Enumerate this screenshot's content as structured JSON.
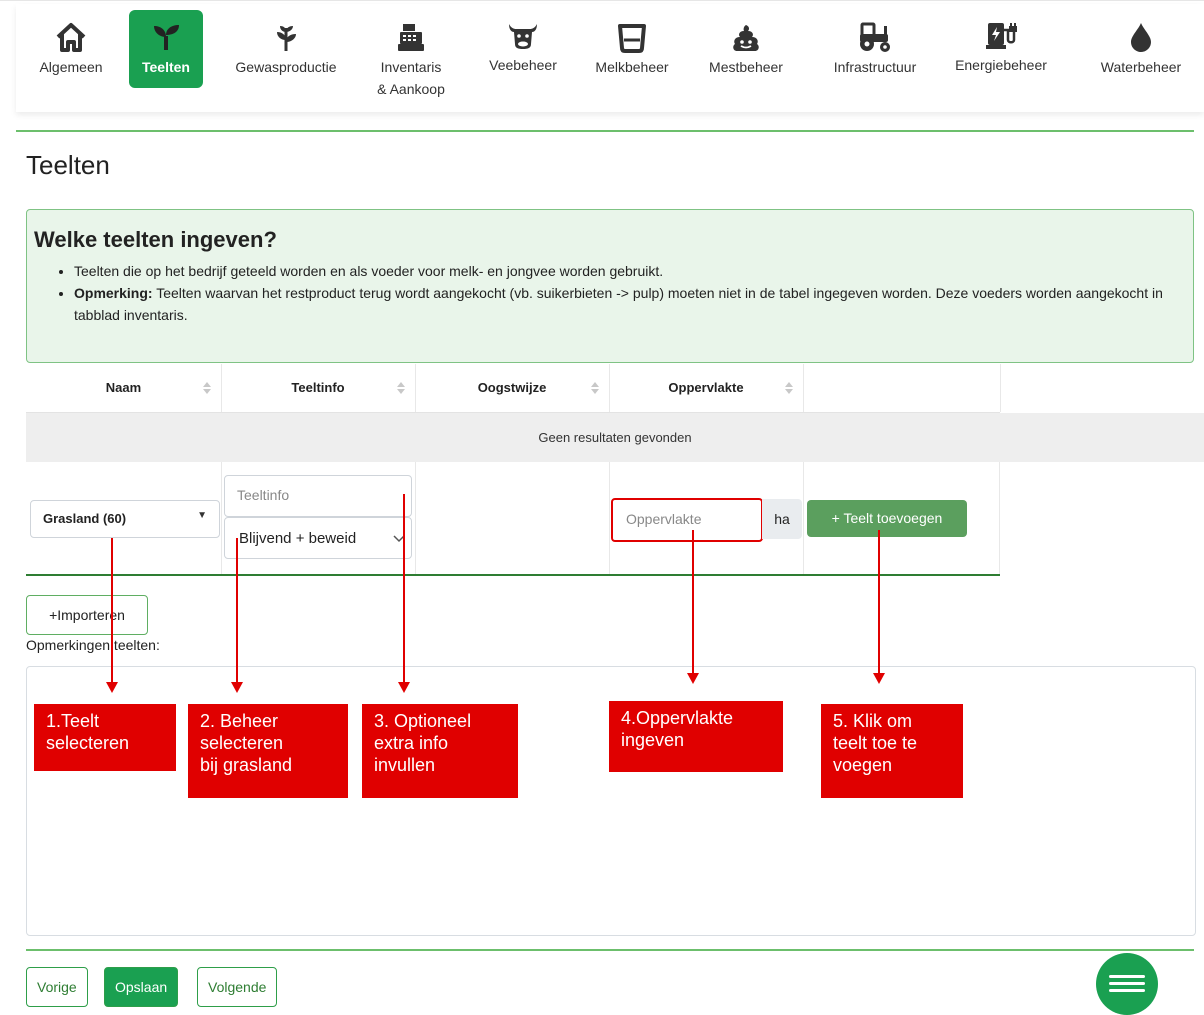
{
  "nav": {
    "items": [
      {
        "label": "Algemeen",
        "icon": "home-icon"
      },
      {
        "label": "Teelten",
        "icon": "seedling-icon",
        "active": true
      },
      {
        "label": "Gewasproductie",
        "icon": "plant-icon"
      },
      {
        "label": "Inventaris",
        "label2": "& Aankoop",
        "icon": "cash-register-icon"
      },
      {
        "label": "Veebeheer",
        "icon": "cow-icon"
      },
      {
        "label": "Melkbeheer",
        "icon": "bucket-icon"
      },
      {
        "label": "Mestbeheer",
        "icon": "manure-icon"
      },
      {
        "label": "Infrastructuur",
        "icon": "tractor-icon"
      },
      {
        "label": "Energiebeheer",
        "icon": "charging-station-icon"
      },
      {
        "label": "Waterbeheer",
        "icon": "water-drop-icon"
      }
    ]
  },
  "page": {
    "title": "Teelten"
  },
  "info": {
    "heading": "Welke teelten ingeven?",
    "bullet1": "Teelten die op het bedrijf geteeld worden en als voeder voor melk- en jongvee worden gebruikt.",
    "bullet2_bold": "Opmerking:",
    "bullet2_text": " Teelten waarvan het restproduct terug wordt aangekocht (vb. suikerbieten -> pulp) moeten niet in de tabel ingegeven worden. Deze voeders worden aangekocht in tabblad inventaris."
  },
  "table": {
    "headers": [
      "Naam",
      "Teeltinfo",
      "Oogstwijze",
      "Oppervlakte"
    ],
    "no_results": "Geen resultaten gevonden"
  },
  "form": {
    "crop_select_value": "Grasland (60)",
    "teeltinfo_placeholder": "Teeltinfo",
    "management_select_value": "Blijvend + beweid",
    "area_placeholder": "Oppervlakte",
    "area_unit": "ha",
    "add_button": "+ Teelt toevoegen"
  },
  "import_button": "+Importeren",
  "remarks_label": "Opmerkingen teelten:",
  "callouts": {
    "c1": [
      "1.Teelt",
      "selecteren"
    ],
    "c2": [
      "2. Beheer",
      "selecteren",
      "bij grasland"
    ],
    "c3": [
      "3. Optioneel",
      "extra info",
      "invullen"
    ],
    "c4": [
      "4.Oppervlakte",
      "ingeven"
    ],
    "c5": [
      "5. Klik om",
      "teelt toe te",
      "voegen"
    ]
  },
  "footer": {
    "prev": "Vorige",
    "save": "Opslaan",
    "next": "Volgende"
  },
  "colors": {
    "accent": "#1aa051",
    "annotation": "#e00000",
    "info_bg": "#e9f5ea"
  }
}
